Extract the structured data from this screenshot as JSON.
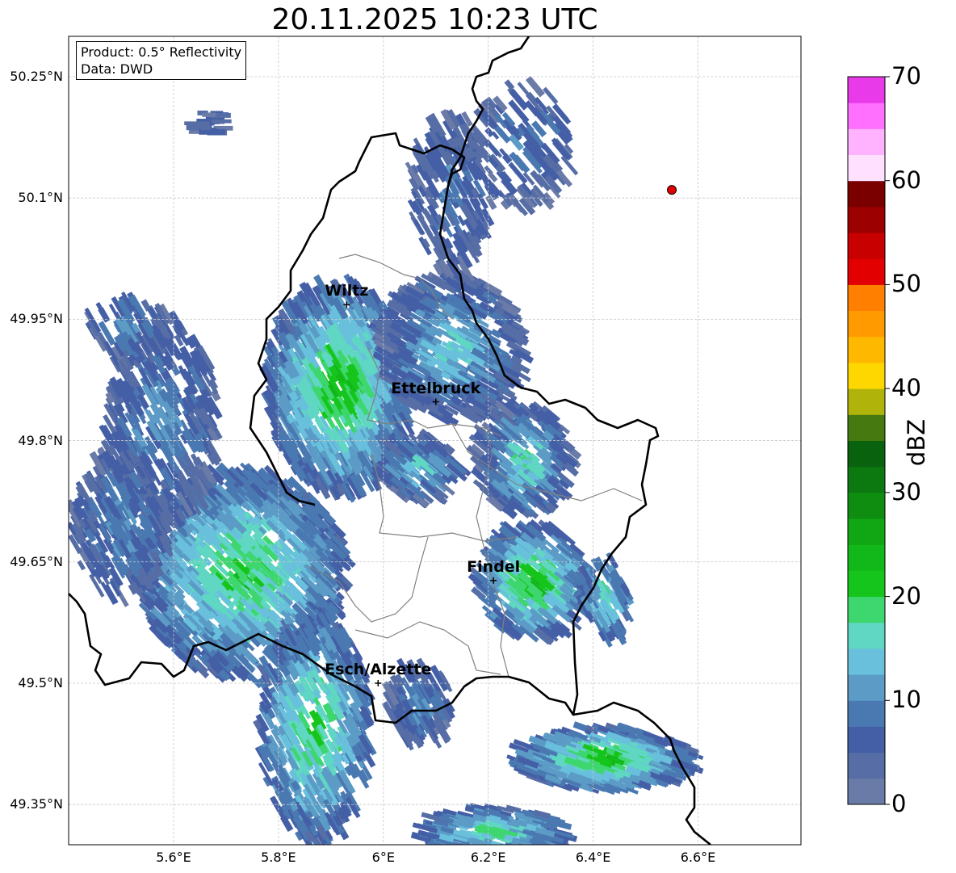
{
  "title": "20.11.2025 10:23 UTC",
  "info": {
    "product": "Product: 0.5° Reflectivity",
    "source": "Data: DWD"
  },
  "lat_ticks": [
    "50.25°N",
    "50.1°N",
    "49.95°N",
    "49.8°N",
    "49.65°N",
    "49.5°N",
    "49.35°N"
  ],
  "lon_ticks": [
    "5.6°E",
    "5.8°E",
    "6°E",
    "6.2°E",
    "6.4°E",
    "6.6°E"
  ],
  "cities": [
    {
      "name": "Wiltz",
      "lon": 5.93,
      "lat": 49.968
    },
    {
      "name": "Ettelbruck",
      "lon": 6.1,
      "lat": 49.848
    },
    {
      "name": "Findel",
      "lon": 6.21,
      "lat": 49.627
    },
    {
      "name": "Esch/Alzette",
      "lon": 5.99,
      "lat": 49.5
    }
  ],
  "radar_site_marker": {
    "lon": 6.55,
    "lat": 50.11,
    "color": "#e00000"
  },
  "map_extent": {
    "lon_min": 5.4,
    "lon_max": 6.8,
    "lat_min": 49.3,
    "lat_max": 50.3
  },
  "colorbar": {
    "label": "dBZ",
    "tick_labels": [
      "0",
      "10",
      "20",
      "30",
      "40",
      "50",
      "60",
      "70"
    ],
    "min": 0,
    "max": 70,
    "step": 2.5,
    "colors": [
      "#6a7ba8",
      "#566ea5",
      "#445fa5",
      "#4a79b2",
      "#5b9bc6",
      "#68c0dc",
      "#5fd7c2",
      "#3ed66e",
      "#16c51c",
      "#12b81a",
      "#10a614",
      "#0e8d10",
      "#0b7810",
      "#09620e",
      "#467a10",
      "#b0b40a",
      "#ffd700",
      "#ffb800",
      "#ff9b00",
      "#ff7f00",
      "#e20000",
      "#c80000",
      "#9c0000",
      "#7a0000",
      "#ffe0ff",
      "#ffb3ff",
      "#ff70ff",
      "#e83ae8"
    ]
  },
  "colors": {
    "country_border": "#000000",
    "canton_border": "#808080",
    "grid": "#c8c8c8"
  }
}
